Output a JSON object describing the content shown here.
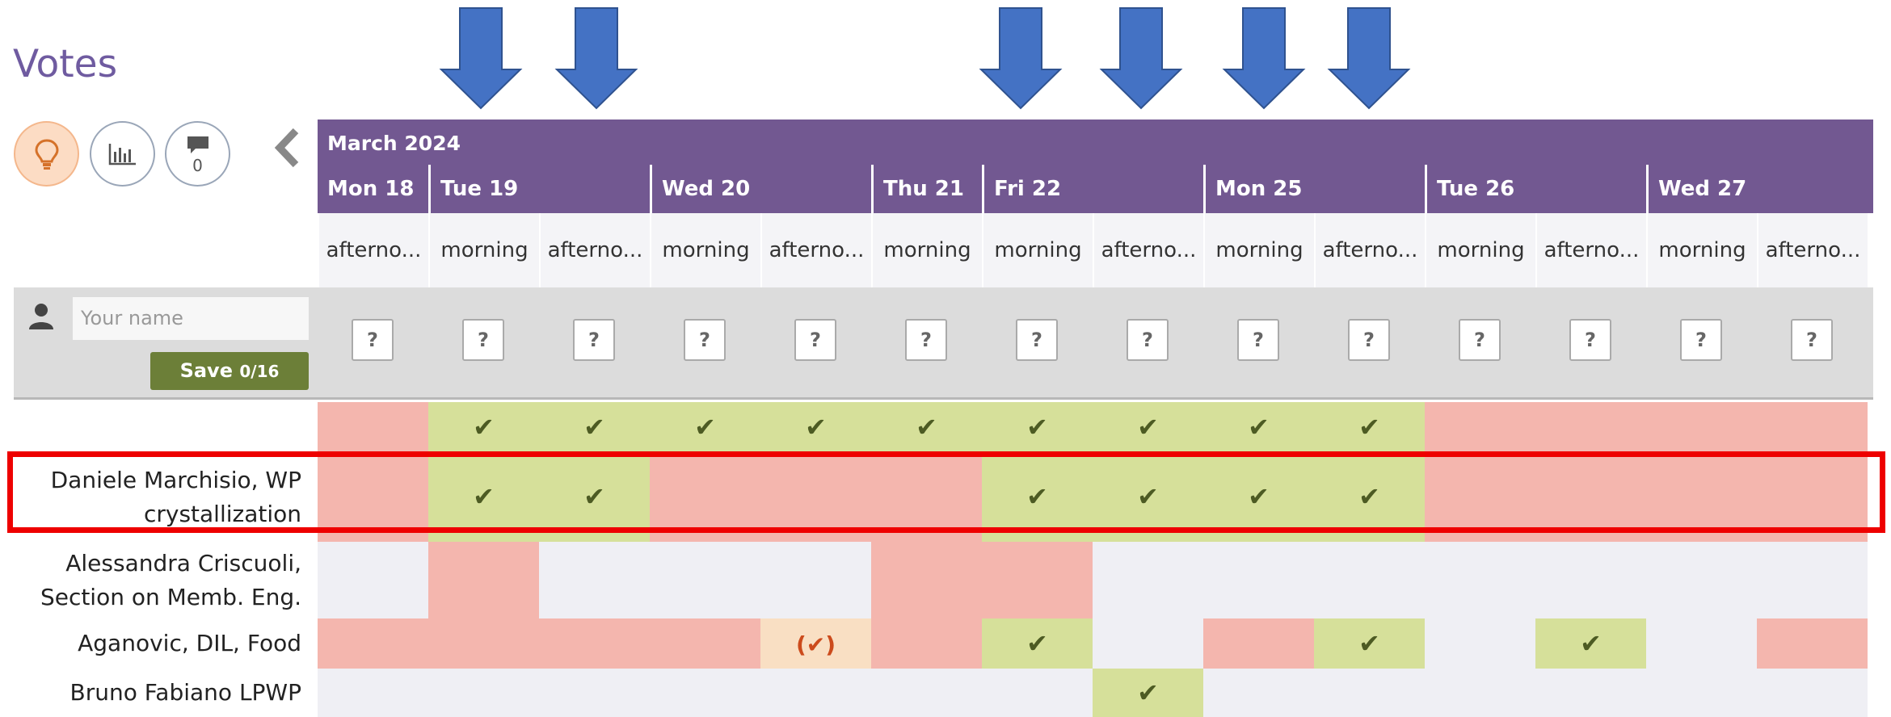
{
  "page_title": "Votes",
  "toolbar": {
    "comments_count": "0"
  },
  "calendar": {
    "month": "March 2024",
    "days": [
      "Mon 18",
      "Tue 19",
      "Wed 20",
      "Thu 21",
      "Fri 22",
      "Mon 25",
      "Tue 26",
      "Wed 27"
    ],
    "slots": [
      "afterno...",
      "morning",
      "afterno...",
      "morning",
      "afterno...",
      "morning",
      "morning",
      "afterno...",
      "morning",
      "afterno...",
      "morning",
      "afterno...",
      "morning",
      "afterno..."
    ]
  },
  "vote_form": {
    "name_placeholder": "Your name",
    "save_label": "Save",
    "save_count": "0/16",
    "unknown_mark": "?"
  },
  "marks": {
    "yes": "✔",
    "maybe": "(✔)"
  },
  "rows": [
    {
      "name": "",
      "votes": [
        "no",
        "yes",
        "yes",
        "yes",
        "yes",
        "yes",
        "yes",
        "yes",
        "yes",
        "yes",
        "no",
        "no",
        "no",
        "no"
      ]
    },
    {
      "name": "Daniele Marchisio, WP crystallization",
      "votes": [
        "no",
        "yes",
        "yes",
        "no",
        "no",
        "no",
        "yes",
        "yes",
        "yes",
        "yes",
        "no",
        "no",
        "no",
        "no"
      ]
    },
    {
      "name": "Alessandra Criscuoli, Section on Memb. Eng.",
      "votes": [
        "blank",
        "no",
        "blank",
        "blank",
        "blank",
        "no",
        "no",
        "blank",
        "blank",
        "blank",
        "blank",
        "blank",
        "blank",
        "blank"
      ]
    },
    {
      "name": "Aganovic, DIL, Food",
      "votes": [
        "no",
        "no",
        "no",
        "no",
        "maybe",
        "no",
        "yes",
        "blank",
        "no",
        "yes",
        "blank",
        "yes",
        "blank",
        "no"
      ]
    },
    {
      "name": "Bruno Fabiano LPWP",
      "votes": [
        "blank",
        "blank",
        "blank",
        "blank",
        "blank",
        "blank",
        "blank",
        "yes",
        "blank",
        "blank",
        "blank",
        "blank",
        "blank",
        "blank"
      ]
    }
  ],
  "annotations": {
    "highlighted_row": "Daniele Marchisio, WP crystallization"
  },
  "colors": {
    "header": "#725891",
    "yes": "#d6e09a",
    "no": "#f4b6ae",
    "maybe": "#f9dfc3",
    "blank": "#efeff4",
    "highlight": "#ee0000",
    "arrow": "#4472c4"
  }
}
